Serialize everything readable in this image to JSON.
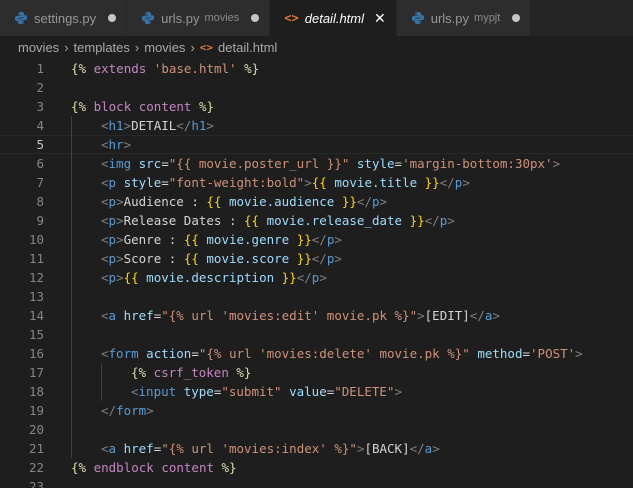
{
  "tabs": [
    {
      "name": "settings.py",
      "desc": "",
      "state": "dirty"
    },
    {
      "name": "urls.py",
      "desc": "movies",
      "state": "dirty"
    },
    {
      "name": "detail.html",
      "desc": "",
      "state": "active"
    },
    {
      "name": "urls.py",
      "desc": "mypjt",
      "state": "dirty"
    }
  ],
  "breadcrumb": [
    "movies",
    "templates",
    "movies",
    "detail.html"
  ],
  "colors": {
    "jinja_delim": "#dcdcaa",
    "keyword": "#c586c0",
    "string": "#ce9178",
    "tag": "#569cd6",
    "attribute": "#9cdcfe",
    "html_icon": "#e37933",
    "python_icon": "#3572a5"
  },
  "icons": {
    "python": "python-file-icon",
    "html": "html-file-icon"
  },
  "editor": {
    "current_line": 5,
    "lines": [
      {
        "n": "1",
        "indent": 0,
        "tokens": [
          [
            "jinja",
            "{%"
          ],
          [
            "kw",
            " extends "
          ],
          [
            "str",
            "'base.html'"
          ],
          [
            "jinja",
            " %}"
          ]
        ]
      },
      {
        "n": "2",
        "indent": 0,
        "tokens": []
      },
      {
        "n": "3",
        "indent": 0,
        "tokens": [
          [
            "jinja",
            "{%"
          ],
          [
            "kw",
            " block content "
          ],
          [
            "jinja",
            "%}"
          ]
        ]
      },
      {
        "n": "4",
        "indent": 1,
        "tokens": [
          [
            "punc",
            "<"
          ],
          [
            "tag",
            "h1"
          ],
          [
            "punc",
            ">"
          ],
          [
            "text",
            "DETAIL"
          ],
          [
            "punc",
            "</"
          ],
          [
            "tag",
            "h1"
          ],
          [
            "punc",
            ">"
          ]
        ]
      },
      {
        "n": "5",
        "indent": 1,
        "tokens": [
          [
            "punc",
            "<"
          ],
          [
            "tag",
            "hr"
          ],
          [
            "punc",
            ">"
          ]
        ]
      },
      {
        "n": "6",
        "indent": 1,
        "tokens": [
          [
            "punc",
            "<"
          ],
          [
            "tag",
            "img"
          ],
          [
            "attr",
            " src"
          ],
          [
            "text",
            "="
          ],
          [
            "str",
            "\"{{ movie.poster_url }}\""
          ],
          [
            "attr",
            " style"
          ],
          [
            "text",
            "="
          ],
          [
            "str",
            "'margin-bottom:30px'"
          ],
          [
            "punc",
            ">"
          ]
        ]
      },
      {
        "n": "7",
        "indent": 1,
        "tokens": [
          [
            "punc",
            "<"
          ],
          [
            "tag",
            "p"
          ],
          [
            "attr",
            " style"
          ],
          [
            "text",
            "="
          ],
          [
            "str",
            "\"font-weight:bold\""
          ],
          [
            "punc",
            ">"
          ],
          [
            "brace",
            "{{"
          ],
          [
            "var",
            " movie.title "
          ],
          [
            "brace",
            "}}"
          ],
          [
            "punc",
            "</"
          ],
          [
            "tag",
            "p"
          ],
          [
            "punc",
            ">"
          ]
        ]
      },
      {
        "n": "8",
        "indent": 1,
        "tokens": [
          [
            "punc",
            "<"
          ],
          [
            "tag",
            "p"
          ],
          [
            "punc",
            ">"
          ],
          [
            "text",
            "Audience : "
          ],
          [
            "brace",
            "{{"
          ],
          [
            "var",
            " movie.audience "
          ],
          [
            "brace",
            "}}"
          ],
          [
            "punc",
            "</"
          ],
          [
            "tag",
            "p"
          ],
          [
            "punc",
            ">"
          ]
        ]
      },
      {
        "n": "9",
        "indent": 1,
        "tokens": [
          [
            "punc",
            "<"
          ],
          [
            "tag",
            "p"
          ],
          [
            "punc",
            ">"
          ],
          [
            "text",
            "Release Dates : "
          ],
          [
            "brace",
            "{{"
          ],
          [
            "var",
            " movie.release_date "
          ],
          [
            "brace",
            "}}"
          ],
          [
            "punc",
            "</"
          ],
          [
            "tag",
            "p"
          ],
          [
            "punc",
            ">"
          ]
        ]
      },
      {
        "n": "10",
        "indent": 1,
        "tokens": [
          [
            "punc",
            "<"
          ],
          [
            "tag",
            "p"
          ],
          [
            "punc",
            ">"
          ],
          [
            "text",
            "Genre : "
          ],
          [
            "brace",
            "{{"
          ],
          [
            "var",
            " movie.genre "
          ],
          [
            "brace",
            "}}"
          ],
          [
            "punc",
            "</"
          ],
          [
            "tag",
            "p"
          ],
          [
            "punc",
            ">"
          ]
        ]
      },
      {
        "n": "11",
        "indent": 1,
        "tokens": [
          [
            "punc",
            "<"
          ],
          [
            "tag",
            "p"
          ],
          [
            "punc",
            ">"
          ],
          [
            "text",
            "Score : "
          ],
          [
            "brace",
            "{{"
          ],
          [
            "var",
            " movie.score "
          ],
          [
            "brace",
            "}}"
          ],
          [
            "punc",
            "</"
          ],
          [
            "tag",
            "p"
          ],
          [
            "punc",
            ">"
          ]
        ]
      },
      {
        "n": "12",
        "indent": 1,
        "tokens": [
          [
            "punc",
            "<"
          ],
          [
            "tag",
            "p"
          ],
          [
            "punc",
            ">"
          ],
          [
            "brace",
            "{{"
          ],
          [
            "var",
            " movie.description "
          ],
          [
            "brace",
            "}}"
          ],
          [
            "punc",
            "</"
          ],
          [
            "tag",
            "p"
          ],
          [
            "punc",
            ">"
          ]
        ]
      },
      {
        "n": "13",
        "indent": 1,
        "tokens": []
      },
      {
        "n": "14",
        "indent": 1,
        "tokens": [
          [
            "punc",
            "<"
          ],
          [
            "tag",
            "a"
          ],
          [
            "attr",
            " href"
          ],
          [
            "text",
            "="
          ],
          [
            "str",
            "\"{% url 'movies:edit' movie.pk %}\""
          ],
          [
            "punc",
            ">"
          ],
          [
            "text",
            "[EDIT]"
          ],
          [
            "punc",
            "</"
          ],
          [
            "tag",
            "a"
          ],
          [
            "punc",
            ">"
          ]
        ]
      },
      {
        "n": "15",
        "indent": 1,
        "tokens": []
      },
      {
        "n": "16",
        "indent": 1,
        "tokens": [
          [
            "punc",
            "<"
          ],
          [
            "tag",
            "form"
          ],
          [
            "attr",
            " action"
          ],
          [
            "text",
            "="
          ],
          [
            "str",
            "\"{% url 'movies:delete' movie.pk %}\""
          ],
          [
            "attr",
            " method"
          ],
          [
            "text",
            "="
          ],
          [
            "str",
            "'POST'"
          ],
          [
            "punc",
            ">"
          ]
        ]
      },
      {
        "n": "17",
        "indent": 2,
        "tokens": [
          [
            "jinja",
            "{%"
          ],
          [
            "kw",
            " csrf_token "
          ],
          [
            "jinja",
            "%}"
          ]
        ]
      },
      {
        "n": "18",
        "indent": 2,
        "tokens": [
          [
            "punc",
            "<"
          ],
          [
            "tag",
            "input"
          ],
          [
            "attr",
            " type"
          ],
          [
            "text",
            "="
          ],
          [
            "str",
            "\"submit\""
          ],
          [
            "attr",
            " value"
          ],
          [
            "text",
            "="
          ],
          [
            "str",
            "\"DELETE\""
          ],
          [
            "punc",
            ">"
          ]
        ]
      },
      {
        "n": "19",
        "indent": 1,
        "tokens": [
          [
            "punc",
            "</"
          ],
          [
            "tag",
            "form"
          ],
          [
            "punc",
            ">"
          ]
        ]
      },
      {
        "n": "20",
        "indent": 1,
        "tokens": []
      },
      {
        "n": "21",
        "indent": 1,
        "tokens": [
          [
            "punc",
            "<"
          ],
          [
            "tag",
            "a"
          ],
          [
            "attr",
            " href"
          ],
          [
            "text",
            "="
          ],
          [
            "str",
            "\"{% url 'movies:index' %}\""
          ],
          [
            "punc",
            ">"
          ],
          [
            "text",
            "[BACK]"
          ],
          [
            "punc",
            "</"
          ],
          [
            "tag",
            "a"
          ],
          [
            "punc",
            ">"
          ]
        ]
      },
      {
        "n": "22",
        "indent": 0,
        "tokens": [
          [
            "jinja",
            "{%"
          ],
          [
            "kw",
            " endblock content "
          ],
          [
            "jinja",
            "%}"
          ]
        ]
      },
      {
        "n": "23",
        "indent": 0,
        "tokens": []
      }
    ]
  }
}
